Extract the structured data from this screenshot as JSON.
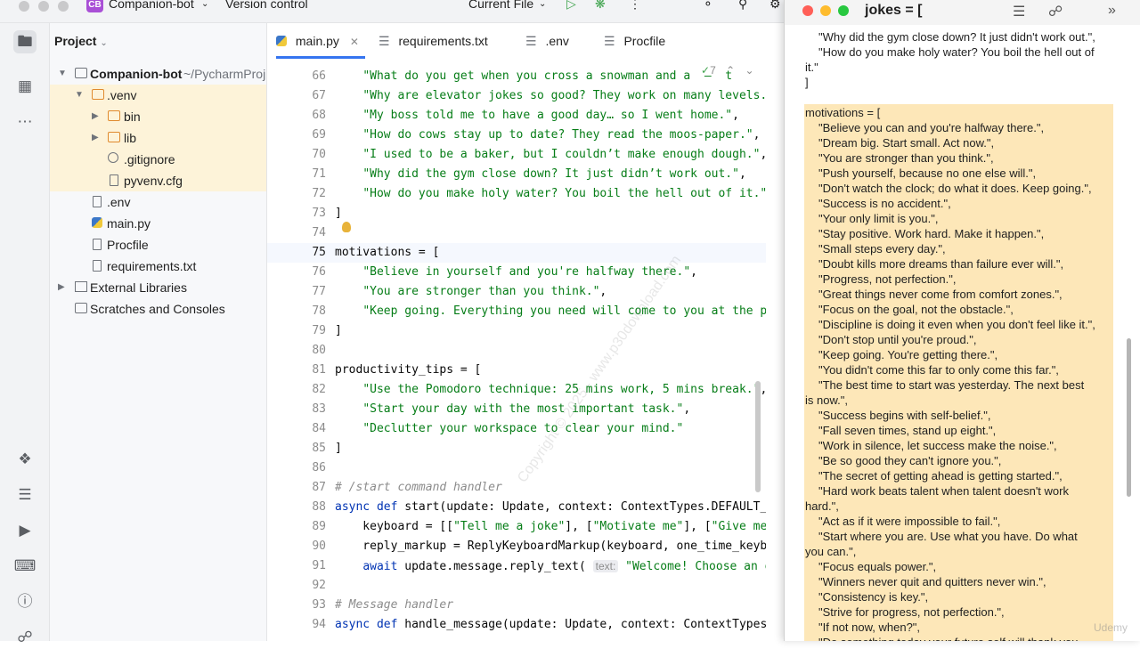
{
  "topbar": {
    "project_badge": "CB",
    "project_name": "Companion-bot",
    "vcs": "Version control",
    "run_config": "Current File"
  },
  "project_panel": {
    "header": "Project",
    "tree": [
      {
        "label": "Companion-bot",
        "suffix": "~/PycharmProj"
      },
      {
        "label": ".venv"
      },
      {
        "label": "bin"
      },
      {
        "label": "lib"
      },
      {
        "label": ".gitignore"
      },
      {
        "label": "pyvenv.cfg"
      },
      {
        "label": ".env"
      },
      {
        "label": "main.py"
      },
      {
        "label": "Procfile"
      },
      {
        "label": "requirements.txt"
      },
      {
        "label": "External Libraries"
      },
      {
        "label": "Scratches and Consoles"
      }
    ]
  },
  "tabs": [
    {
      "label": "main.py"
    },
    {
      "label": "requirements.txt"
    },
    {
      "label": ".env"
    },
    {
      "label": "Procfile"
    }
  ],
  "editor": {
    "inspection_count": "7",
    "lines": [
      {
        "n": "66",
        "code": "    \"What do you get when you cross a snowman and a  —  t"
      },
      {
        "n": "67",
        "code": "    \"Why are elevator jokes so good? They work on many levels."
      },
      {
        "n": "68",
        "code": "    \"My boss told me to have a good day… so I went home.\","
      },
      {
        "n": "69",
        "code": "    \"How do cows stay up to date? They read the moos-paper.\","
      },
      {
        "n": "70",
        "code": "    \"I used to be a baker, but I couldn’t make enough dough.\","
      },
      {
        "n": "71",
        "code": "    \"Why did the gym close down? It just didn’t work out.\","
      },
      {
        "n": "72",
        "code": "    \"How do you make holy water? You boil the hell out of it.\""
      },
      {
        "n": "73",
        "code": "]"
      },
      {
        "n": "74",
        "code": ""
      },
      {
        "n": "75",
        "code": "motivations = ["
      },
      {
        "n": "76",
        "code": "    \"Believe in yourself and you're halfway there.\","
      },
      {
        "n": "77",
        "code": "    \"You are stronger than you think.\","
      },
      {
        "n": "78",
        "code": "    \"Keep going. Everything you need will come to you at the p"
      },
      {
        "n": "79",
        "code": "]"
      },
      {
        "n": "80",
        "code": ""
      },
      {
        "n": "81",
        "code": "productivity_tips = ["
      },
      {
        "n": "82",
        "code": "    \"Use the Pomodoro technique: 25 mins work, 5 mins break.\","
      },
      {
        "n": "83",
        "code": "    \"Start your day with the most important task.\","
      },
      {
        "n": "84",
        "code": "    \"Declutter your workspace to clear your mind.\""
      },
      {
        "n": "85",
        "code": "]"
      },
      {
        "n": "86",
        "code": ""
      },
      {
        "n": "87",
        "code": "# /start command handler"
      },
      {
        "n": "88",
        "code": "async def start(update: Update, context: ContextTypes.DEFAULT_"
      },
      {
        "n": "89",
        "code": "    keyboard = [[\"Tell me a joke\"], [\"Motivate me\"], [\"Give me"
      },
      {
        "n": "90",
        "code": "    reply_markup = ReplyKeyboardMarkup(keyboard, one_time_keyb"
      },
      {
        "n": "91",
        "code": "    await update.message.reply_text( text: \"Welcome! Choose an o"
      },
      {
        "n": "92",
        "code": ""
      },
      {
        "n": "93",
        "code": "# Message handler"
      },
      {
        "n": "94",
        "code": "async def handle_message(update: Update, context: ContextTypes"
      }
    ],
    "watermark": "Copyright © 2025 - www.p30download.com"
  },
  "notes": {
    "title": "jokes = [",
    "top_lines": [
      "\"Why did the gym close down? It just didn't work out.\",",
      "\"How do you make holy water? You boil the hell out of",
      "it.\"",
      "]"
    ],
    "motivations_header": "motivations = [",
    "motivations": [
      "\"Believe you can and you're halfway there.\",",
      "\"Dream big. Start small. Act now.\",",
      "\"You are stronger than you think.\",",
      "\"Push yourself, because no one else will.\",",
      "\"Don't watch the clock; do what it does. Keep going.\",",
      "\"Success is no accident.\",",
      "\"Your only limit is you.\",",
      "\"Stay positive. Work hard. Make it happen.\",",
      "\"Small steps every day.\",",
      "\"Doubt kills more dreams than failure ever will.\",",
      "\"Progress, not perfection.\",",
      "\"Great things never come from comfort zones.\",",
      "\"Focus on the goal, not the obstacle.\",",
      "\"Discipline is doing it even when you don't feel like it.\",",
      "\"Don't stop until you're proud.\",",
      "\"Keep going. You're getting there.\",",
      "\"You didn't come this far to only come this far.\",",
      "\"The best time to start was yesterday. The next best",
      "is now.\",",
      "\"Success begins with self-belief.\",",
      "\"Fall seven times, stand up eight.\",",
      "\"Work in silence, let success make the noise.\",",
      "\"Be so good they can't ignore you.\",",
      "\"The secret of getting ahead is getting started.\",",
      "\"Hard work beats talent when talent doesn't work",
      "hard.\",",
      "\"Act as if it were impossible to fail.\",",
      "\"Start where you are. Use what you have. Do what",
      "you can.\",",
      "\"Focus equals power.\",",
      "\"Winners never quit and quitters never win.\",",
      "\"Consistency is key.\",",
      "\"Strive for progress, not perfection.\",",
      "\"If not now, when?\",",
      "\"Do something today your future self will thank you"
    ]
  },
  "watermark_udemy": "Udemy",
  "colors": {
    "accent": "#3574f0",
    "selection": "#fde7b8",
    "string": "#067d17",
    "keyword": "#0033b3"
  }
}
